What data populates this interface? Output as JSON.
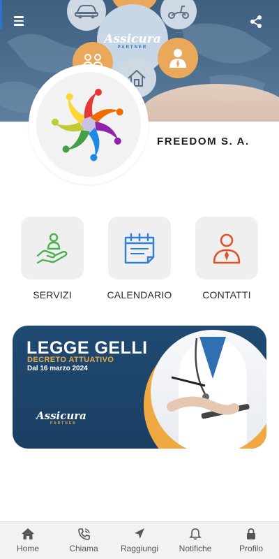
{
  "header": {
    "menu_icon": "hamburger-menu-icon",
    "share_icon": "share-icon",
    "brand_text": "Assicura",
    "brand_sub": "PARTNER",
    "brand_script": "point"
  },
  "company": {
    "name": "FREEDOM S. A."
  },
  "actions": [
    {
      "label": "SERVIZI",
      "icon": "hand-person-icon",
      "color": "#4caf50"
    },
    {
      "label": "CALENDARIO",
      "icon": "calendar-icon",
      "color": "#2f80d0"
    },
    {
      "label": "CONTATTI",
      "icon": "contact-person-icon",
      "color": "#e2502a"
    }
  ],
  "banner": {
    "title": "LEGGE GELLI",
    "subtitle": "DECRETO ATTUATIVO",
    "date": "Dal 16 marzo 2024",
    "logo_text": "Assicura",
    "logo_sub": "PARTNER",
    "logo_script": "point",
    "accent": "#f0a940",
    "background": "#1f4a72"
  },
  "bottom_nav": [
    {
      "label": "Home",
      "icon": "home-icon"
    },
    {
      "label": "Chiama",
      "icon": "phone-icon"
    },
    {
      "label": "Raggiungi",
      "icon": "navigation-arrow-icon"
    },
    {
      "label": "Notifiche",
      "icon": "bell-icon"
    },
    {
      "label": "Profilo",
      "icon": "lock-icon"
    }
  ]
}
